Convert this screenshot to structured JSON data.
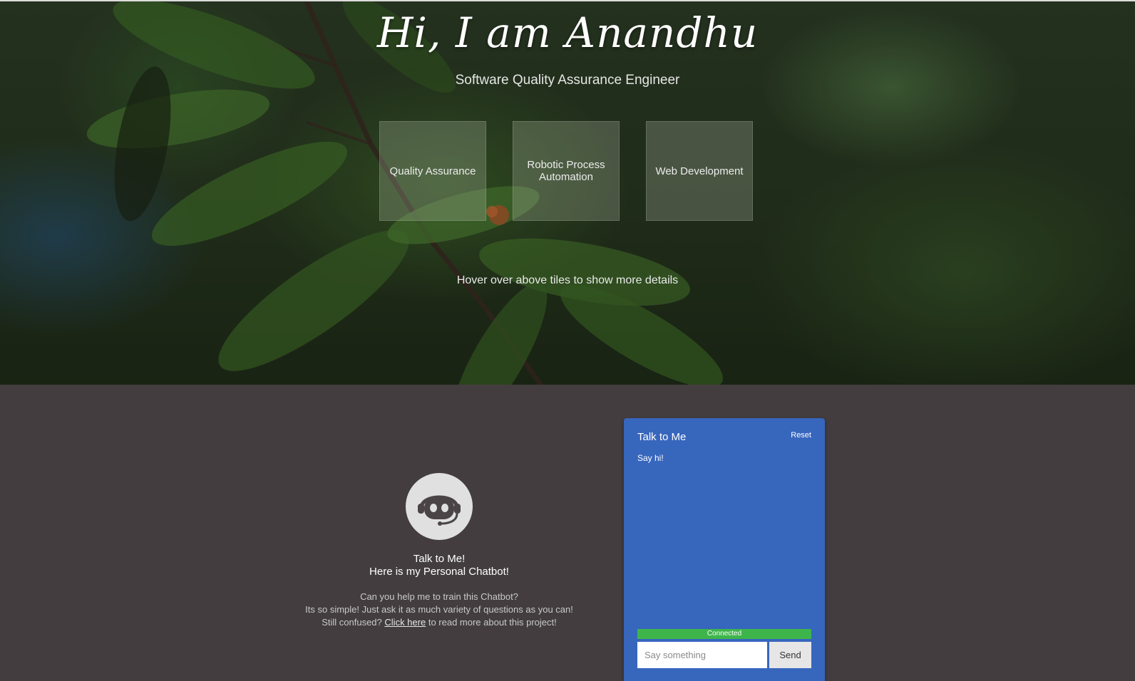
{
  "hero": {
    "title": "Hi, I am Anandhu",
    "subtitle": "Software Quality Assurance Engineer",
    "tiles": [
      {
        "label": "Quality Assurance"
      },
      {
        "label": "Robotic Process Automation"
      },
      {
        "label": "Web Development"
      }
    ],
    "hint": "Hover over above tiles to show more details"
  },
  "intro": {
    "line1": "Talk to Me!",
    "line2": "Here is my Personal Chatbot!",
    "desc1": "Can you help me to train this Chatbot?",
    "desc2": "Its so simple! Just ask it as much variety of questions as you can!",
    "desc3_before": "Still confused?",
    "desc3_link": "Click here",
    "desc3_after": "to read more about this project!"
  },
  "chat": {
    "title": "Talk to Me",
    "reset_label": "Reset",
    "message": "Say hi!",
    "status": "Connected",
    "input_placeholder": "Say something",
    "send_label": "Send"
  },
  "colors": {
    "page_bg": "#433d3f",
    "chat_panel": "#3766bd",
    "status_green": "#3eb54a",
    "avatar_bg": "#e0e0e0"
  },
  "icons": {
    "avatar": "robot-headset-icon"
  }
}
